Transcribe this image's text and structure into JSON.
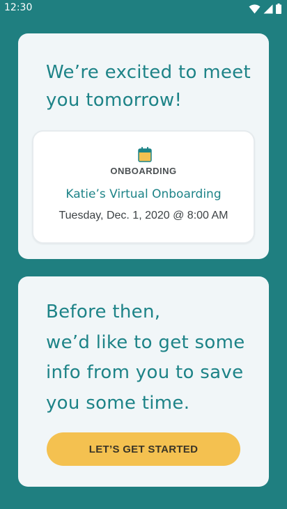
{
  "status_bar": {
    "time": "12:30",
    "icons": [
      "wifi-icon",
      "signal-icon",
      "battery-icon"
    ]
  },
  "welcome_card": {
    "heading_line1": "We’re excited to meet",
    "heading_line2": "you tomorrow!",
    "event": {
      "icon": "calendar-icon",
      "type": "ONBOARDING",
      "title": "Katie’s Virtual Onboarding",
      "datetime": "Tuesday, Dec. 1, 2020 @ 8:00 AM"
    }
  },
  "info_card": {
    "line1": "Before then,",
    "line2": "we’d like to get some",
    "line3": "info from you to save",
    "line4": "you some time.",
    "button_label": "LET’S GET STARTED"
  },
  "colors": {
    "background": "#1f7f80",
    "card": "#f1f6f8",
    "accent_teal": "#1d8387",
    "button_yellow": "#f4c150"
  }
}
